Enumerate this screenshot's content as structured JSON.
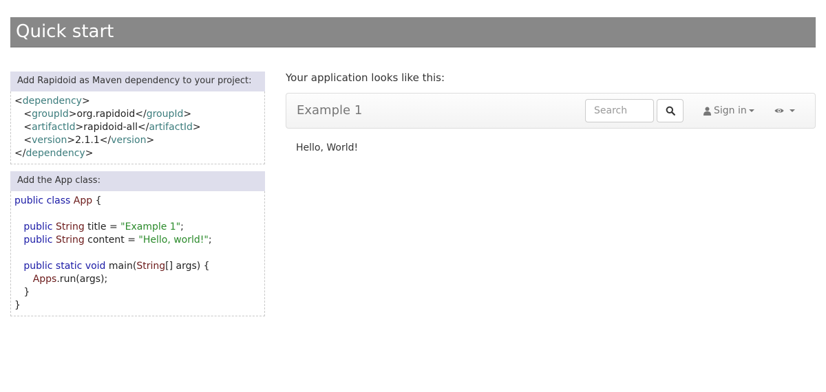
{
  "page_title": "Quick start",
  "maven": {
    "header": "Add Rapidoid as Maven dependency to your project:",
    "lines": [
      [
        {
          "t": "<",
          "c": "pl"
        },
        {
          "t": "dependency",
          "c": "tag"
        },
        {
          "t": ">",
          "c": "pl"
        }
      ],
      [
        {
          "t": "   <",
          "c": "pl"
        },
        {
          "t": "groupId",
          "c": "tag"
        },
        {
          "t": ">org.rapidoid</",
          "c": "pl"
        },
        {
          "t": "groupId",
          "c": "tag"
        },
        {
          "t": ">",
          "c": "pl"
        }
      ],
      [
        {
          "t": "   <",
          "c": "pl"
        },
        {
          "t": "artifactId",
          "c": "tag"
        },
        {
          "t": ">rapidoid-all</",
          "c": "pl"
        },
        {
          "t": "artifactId",
          "c": "tag"
        },
        {
          "t": ">",
          "c": "pl"
        }
      ],
      [
        {
          "t": "   <",
          "c": "pl"
        },
        {
          "t": "version",
          "c": "tag"
        },
        {
          "t": ">2.1.1</",
          "c": "pl"
        },
        {
          "t": "version",
          "c": "tag"
        },
        {
          "t": ">",
          "c": "pl"
        }
      ],
      [
        {
          "t": "</",
          "c": "pl"
        },
        {
          "t": "dependency",
          "c": "tag"
        },
        {
          "t": ">",
          "c": "pl"
        }
      ]
    ]
  },
  "app_class": {
    "header": "Add the App class:",
    "lines": [
      [
        {
          "t": "public class ",
          "c": "kw"
        },
        {
          "t": "App",
          "c": "ty"
        },
        {
          "t": " {",
          "c": "pl"
        }
      ],
      [],
      [
        {
          "t": "   public ",
          "c": "kw"
        },
        {
          "t": "String",
          "c": "ty"
        },
        {
          "t": " title = ",
          "c": "pl"
        },
        {
          "t": "\"Example 1\"",
          "c": "str"
        },
        {
          "t": ";",
          "c": "pl"
        }
      ],
      [
        {
          "t": "   public ",
          "c": "kw"
        },
        {
          "t": "String",
          "c": "ty"
        },
        {
          "t": " content = ",
          "c": "pl"
        },
        {
          "t": "\"Hello, world!\"",
          "c": "str"
        },
        {
          "t": ";",
          "c": "pl"
        }
      ],
      [],
      [
        {
          "t": "   public static void ",
          "c": "kw"
        },
        {
          "t": "main(",
          "c": "pl"
        },
        {
          "t": "String",
          "c": "ty"
        },
        {
          "t": "[] args) {",
          "c": "pl"
        }
      ],
      [
        {
          "t": "      ",
          "c": "pl"
        },
        {
          "t": "Apps",
          "c": "ty"
        },
        {
          "t": ".run(args);",
          "c": "pl"
        }
      ],
      [
        {
          "t": "   }",
          "c": "pl"
        }
      ],
      [
        {
          "t": "}",
          "c": "pl"
        }
      ]
    ]
  },
  "preview": {
    "heading": "Your application looks like this:",
    "brand": "Example 1",
    "search_placeholder": "Search",
    "search_icon": "search-icon",
    "signin_label": "Sign in",
    "user_icon": "user-icon",
    "view_icon": "eye-icon",
    "content": "Hello, World!"
  }
}
